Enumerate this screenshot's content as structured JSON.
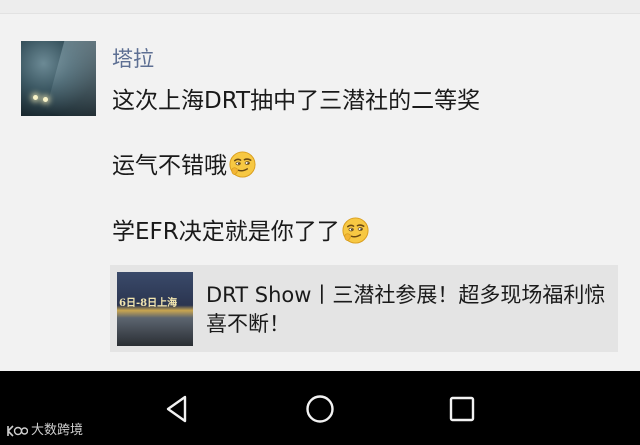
{
  "chat": {
    "sender_name": "塔拉",
    "avatar": "diver-avatar",
    "messages": [
      {
        "text": "这次上海DRT抽中了三潜社的二等奖"
      },
      {
        "text": "运气不错哦",
        "emoji": "smirk-emoji"
      },
      {
        "text": "学EFR决定就是你了了",
        "emoji": "smirk-emoji"
      }
    ],
    "link_card": {
      "title": "DRT Show丨三潜社参展！超多现场福利惊喜不断！",
      "thumbnail_text": "6日-8日上海"
    }
  },
  "navbar": {
    "buttons": [
      "back-icon",
      "home-icon",
      "recent-apps-icon"
    ]
  },
  "watermark": {
    "text": "大数跨境"
  }
}
